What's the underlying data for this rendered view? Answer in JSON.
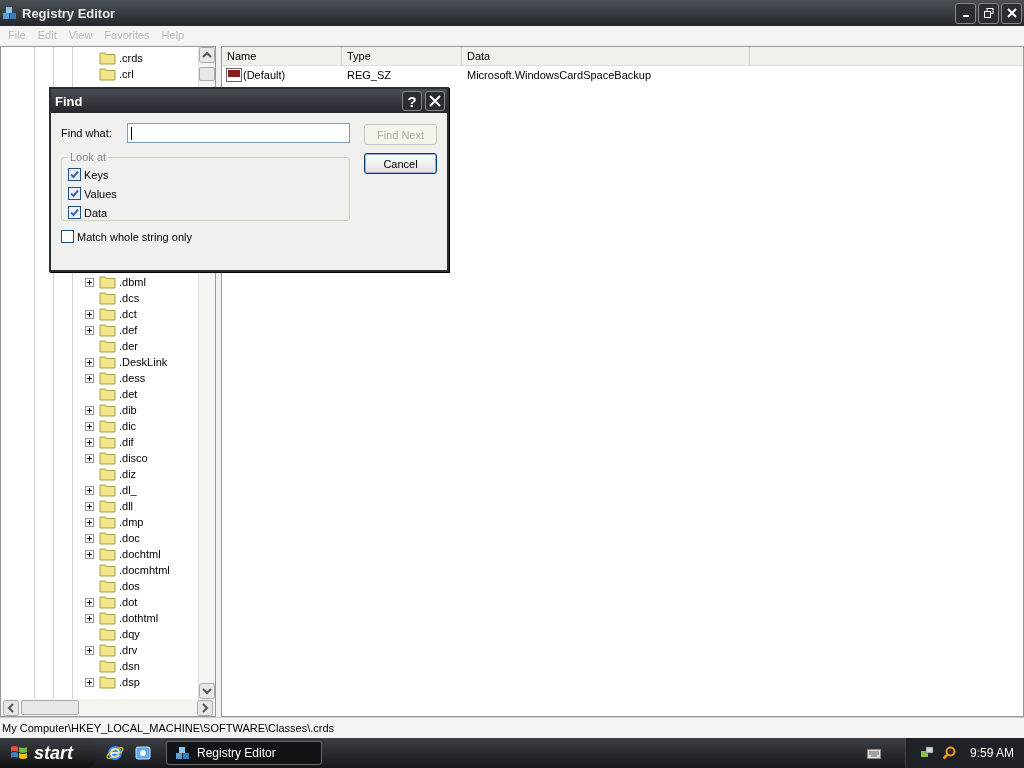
{
  "window": {
    "title": "Registry Editor"
  },
  "menu": [
    {
      "label": "File",
      "disabled": true
    },
    {
      "label": "Edit",
      "disabled": true
    },
    {
      "label": "View",
      "disabled": true
    },
    {
      "label": "Favorites",
      "disabled": true
    },
    {
      "label": "Help",
      "disabled": true
    }
  ],
  "tree": {
    "upper": [
      {
        "label": ".crds",
        "expandable": false
      },
      {
        "label": ".crl",
        "expandable": false
      }
    ],
    "lower": [
      {
        "label": ".dbml",
        "expandable": true
      },
      {
        "label": ".dcs",
        "expandable": false
      },
      {
        "label": ".dct",
        "expandable": true
      },
      {
        "label": ".def",
        "expandable": true
      },
      {
        "label": ".der",
        "expandable": false
      },
      {
        "label": ".DeskLink",
        "expandable": true
      },
      {
        "label": ".dess",
        "expandable": true
      },
      {
        "label": ".det",
        "expandable": false
      },
      {
        "label": ".dib",
        "expandable": true
      },
      {
        "label": ".dic",
        "expandable": true
      },
      {
        "label": ".dif",
        "expandable": true
      },
      {
        "label": ".disco",
        "expandable": true
      },
      {
        "label": ".diz",
        "expandable": false
      },
      {
        "label": ".dl_",
        "expandable": true
      },
      {
        "label": ".dll",
        "expandable": true
      },
      {
        "label": ".dmp",
        "expandable": true
      },
      {
        "label": ".doc",
        "expandable": true
      },
      {
        "label": ".dochtml",
        "expandable": true
      },
      {
        "label": ".docmhtml",
        "expandable": false
      },
      {
        "label": ".dos",
        "expandable": false
      },
      {
        "label": ".dot",
        "expandable": true
      },
      {
        "label": ".dothtml",
        "expandable": true
      },
      {
        "label": ".dqy",
        "expandable": false
      },
      {
        "label": ".drv",
        "expandable": true
      },
      {
        "label": ".dsn",
        "expandable": false
      },
      {
        "label": ".dsp",
        "expandable": true
      }
    ]
  },
  "values_table": {
    "columns": [
      "Name",
      "Type",
      "Data"
    ],
    "rows": [
      {
        "name": "(Default)",
        "type": "REG_SZ",
        "data": "Microsoft.WindowsCardSpaceBackup"
      }
    ]
  },
  "find_dialog": {
    "title": "Find",
    "help": "?",
    "find_label": "Find what:",
    "find_next": {
      "label": "Find Next",
      "disabled": true
    },
    "cancel": "Cancel",
    "look_at_label": "Look at",
    "look_at": [
      {
        "label": "Keys",
        "checked": true
      },
      {
        "label": "Values",
        "checked": true
      },
      {
        "label": "Data",
        "checked": true
      }
    ],
    "match_whole": {
      "label": "Match whole string only",
      "checked": false
    }
  },
  "status_bar": "My Computer\\HKEY_LOCAL_MACHINE\\SOFTWARE\\Classes\\.crds",
  "taskbar": {
    "start": "start",
    "tasks": [
      {
        "label": "Registry Editor",
        "selected": true
      }
    ],
    "clock": "9:59 AM"
  }
}
